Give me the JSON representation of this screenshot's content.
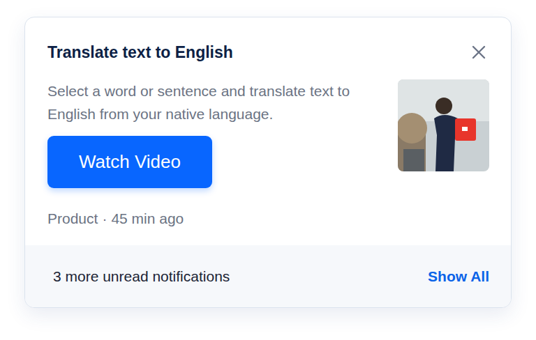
{
  "notification": {
    "title": "Translate text to English",
    "description": "Select a word or sentence and translate text to English from your native language.",
    "button": "Watch Video",
    "meta": {
      "category": "Product",
      "separator": "·",
      "time": "45 min ago"
    }
  },
  "footer": {
    "text": "3 more unread notifications",
    "action": "Show All"
  }
}
